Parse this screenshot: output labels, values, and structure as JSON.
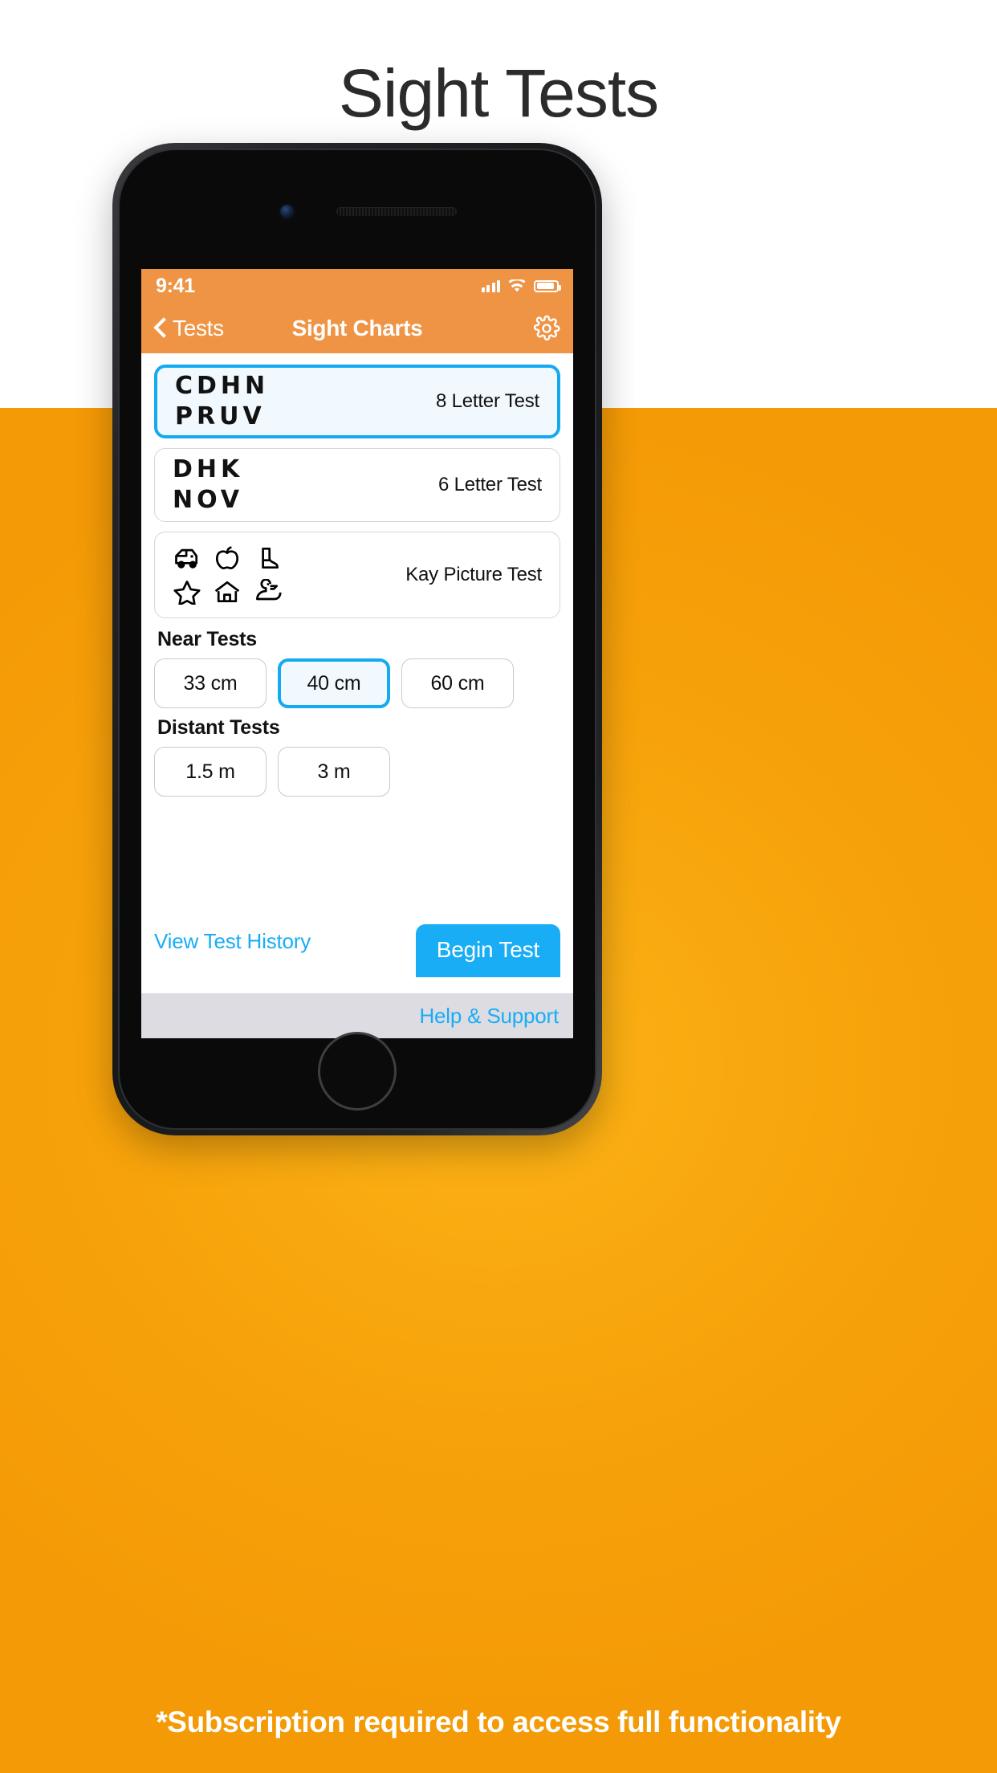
{
  "page": {
    "headline": "Sight Tests",
    "footnote": "*Subscription required to access full functionality",
    "bg_white": "#ffffff",
    "bg_orange": "#F7A30C"
  },
  "statusbar": {
    "time": "9:41",
    "signal_icon": "cellular-bars-icon",
    "wifi_icon": "wifi-icon",
    "battery_icon": "battery-icon"
  },
  "navbar": {
    "back_label": "Tests",
    "title": "Sight Charts",
    "back_icon": "chevron-left-icon",
    "settings_icon": "gear-icon",
    "bar_color": "#EF9444"
  },
  "tests": [
    {
      "letters": "CDHN\nPRUV",
      "label": "8 Letter Test",
      "selected": true,
      "type": "letters"
    },
    {
      "letters": "DHK\nNOV",
      "label": "6 Letter Test",
      "selected": false,
      "type": "letters"
    },
    {
      "label": "Kay Picture Test",
      "selected": false,
      "type": "pictures",
      "icons": [
        "car-icon",
        "apple-icon",
        "boot-icon",
        "star-icon",
        "house-icon",
        "duck-icon"
      ]
    }
  ],
  "near": {
    "title": "Near Tests",
    "options": [
      {
        "label": "33 cm",
        "selected": false
      },
      {
        "label": "40 cm",
        "selected": true
      },
      {
        "label": "60 cm",
        "selected": false
      }
    ]
  },
  "distant": {
    "title": "Distant Tests",
    "options": [
      {
        "label": "1.5 m",
        "selected": false
      },
      {
        "label": "3 m",
        "selected": false
      }
    ]
  },
  "actions": {
    "history_link": "View Test History",
    "begin_label": "Begin Test",
    "accent": "#18ADF5"
  },
  "bottombar": {
    "help_label": "Help & Support"
  }
}
